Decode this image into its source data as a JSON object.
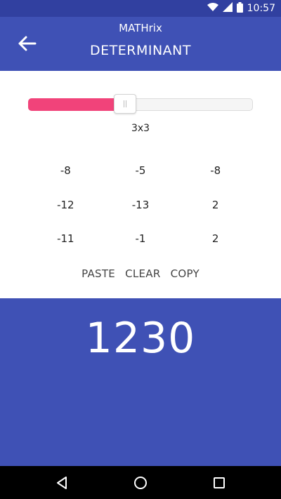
{
  "status_bar": {
    "time": "10:57",
    "icons": [
      "wifi-icon",
      "signal-icon",
      "battery-icon"
    ]
  },
  "app_bar": {
    "app_name": "MATHrix",
    "screen_title": "DETERMINANT",
    "back_icon": "arrow-left-icon"
  },
  "matrix_size": {
    "label": "3x3",
    "slider_fraction": 0.39
  },
  "matrix": {
    "rows": [
      [
        "-8",
        "-5",
        "-8"
      ],
      [
        "-12",
        "-13",
        "2"
      ],
      [
        "-11",
        "-1",
        "2"
      ]
    ]
  },
  "actions": {
    "paste": "PASTE",
    "clear": "CLEAR",
    "copy": "COPY"
  },
  "result": {
    "value": "1230"
  },
  "nav": {
    "icons": [
      "back-triangle-icon",
      "home-circle-icon",
      "recents-square-icon"
    ]
  },
  "colors": {
    "primary": "#3f51b5",
    "primary_dark": "#3140a0",
    "accent": "#f1437a"
  }
}
